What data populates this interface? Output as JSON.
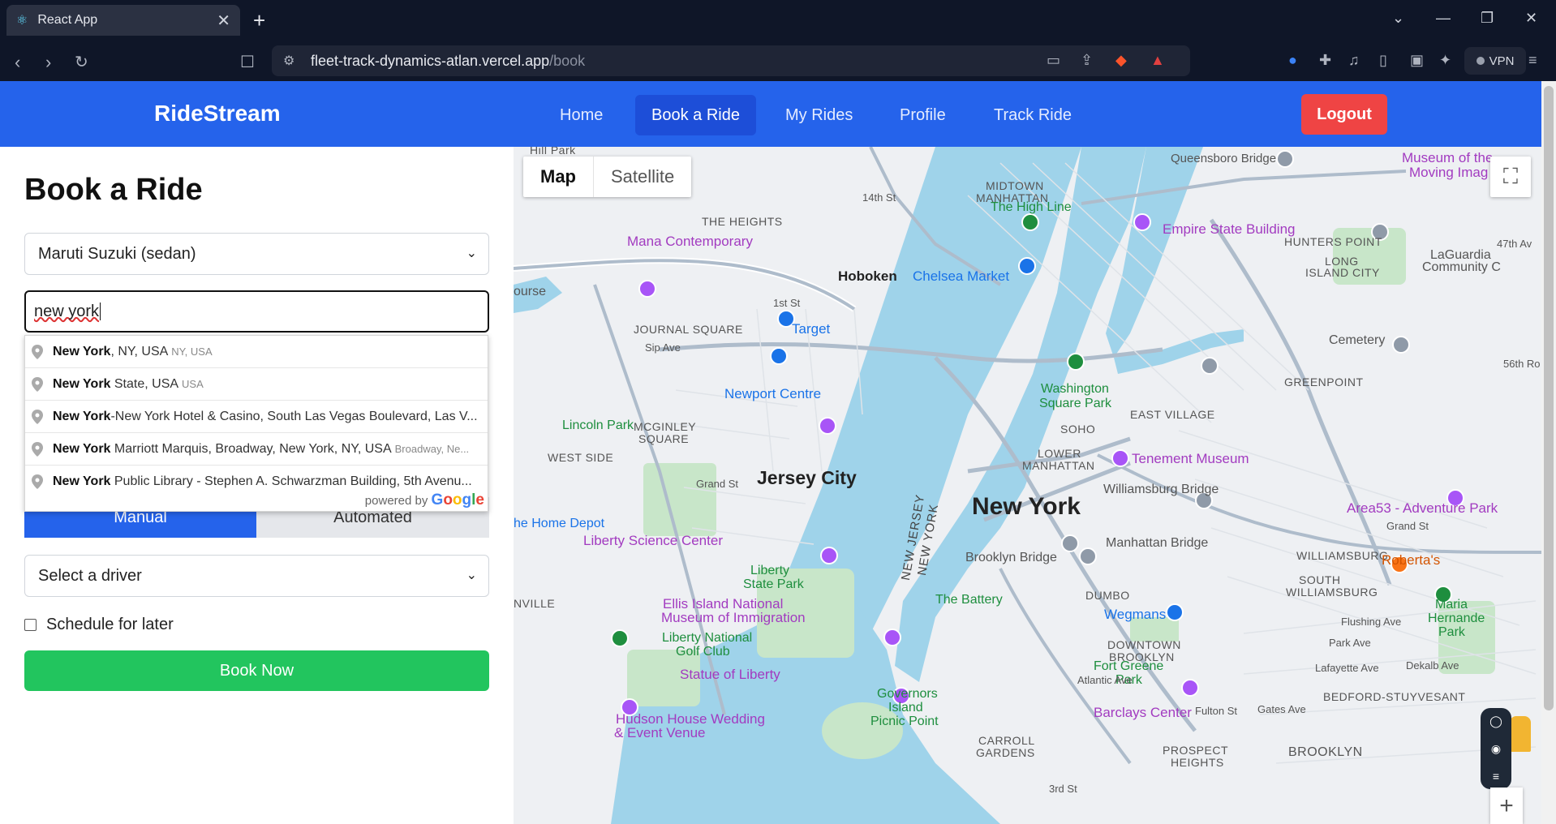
{
  "browser": {
    "tab_title": "React App",
    "tab_close": "✕",
    "new_tab": "+",
    "url_host": "fleet-track-dynamics-atlan.vercel.app",
    "url_path": "/book",
    "vpn_label": "VPN"
  },
  "header": {
    "brand": "RideStream",
    "nav": [
      {
        "label": "Home",
        "active": false
      },
      {
        "label": "Book a Ride",
        "active": true
      },
      {
        "label": "My Rides",
        "active": false
      },
      {
        "label": "Profile",
        "active": false
      },
      {
        "label": "Track Ride",
        "active": false
      }
    ],
    "logout": "Logout",
    "brand_color": "#2563eb",
    "logout_color": "#ef4444"
  },
  "form": {
    "title": "Book a Ride",
    "vehicle_selected": "Maruti Suzuki (sedan)",
    "location_value": "new york",
    "mode_manual": "Manual",
    "mode_automated": "Automated",
    "driver_selected": "Select a driver",
    "schedule_label": "Schedule for later",
    "schedule_checked": false,
    "book_button": "Book Now",
    "book_color": "#22c55e"
  },
  "autocomplete": {
    "items": [
      {
        "match": "New York",
        "rest": ", NY, USA",
        "secondary": "NY, USA"
      },
      {
        "match": "New York",
        "rest": " State, USA",
        "secondary": "USA"
      },
      {
        "match": "New York",
        "rest": "-New York Hotel & Casino, South Las Vegas Boulevard, Las V...",
        "secondary": ""
      },
      {
        "match": "New York",
        "rest": " Marriott Marquis, Broadway, New York, NY, USA",
        "secondary": "Broadway, Ne..."
      },
      {
        "match": "New York",
        "rest": " Public Library - Stephen A. Schwarzman Building, 5th Avenu...",
        "secondary": ""
      }
    ],
    "powered_by": "powered by",
    "google": [
      "G",
      "o",
      "o",
      "g",
      "l",
      "e"
    ]
  },
  "map": {
    "type_map": "Map",
    "type_satellite": "Satellite",
    "labels": {
      "hill_park": "Hill Park",
      "the_heights": "THE HEIGHTS",
      "hoboken": "Hoboken",
      "chelsea_market": "Chelsea Market",
      "the_high_line": "The High Line",
      "midtown": "MIDTOWN",
      "manhattan": "MANHATTAN",
      "queensboro": "Queensboro Bridge",
      "museum_moving": "Museum of the",
      "museum_moving2": "Moving Imag",
      "empire_state": "Empire State Building",
      "hunters_point": "HUNTERS POINT",
      "long_island": "LONG",
      "long_island2": "ISLAND CITY",
      "laguardia": "LaGuardia",
      "laguardia2": "Community C",
      "mana": "Mana Contemporary",
      "ourse": "ourse",
      "journal_square": "JOURNAL SQUARE",
      "target": "Target",
      "newport": "Newport Centre",
      "washington_sq": "Washington",
      "washington_sq2": "Square Park",
      "east_village": "EAST VILLAGE",
      "cemetery": "Cemetery",
      "greenpoint": "GREENPOINT",
      "lincoln_park": "Lincoln Park",
      "mcginley": "MCGINLEY",
      "mcginley2": "SQUARE",
      "west_side": "WEST SIDE",
      "soho": "SOHO",
      "lower": "LOWER",
      "lower2": "MANHATTAN",
      "tenement": "Tenement Museum",
      "jersey_city": "Jersey City",
      "new_york": "New York",
      "williamsburg_bridge": "Williamsburg Bridge",
      "area53": "Area53 - Adventure Park",
      "home_depot": "he Home Depot",
      "liberty_sci": "Liberty Science Center",
      "new_jersey": "NEW JERSEY",
      "new_york_state": "NEW YORK",
      "manhattan_bridge": "Manhattan Bridge",
      "williamsburg": "WILLIAMSBURG",
      "south_williamsburg": "SOUTH",
      "south_williamsburg2": "WILLIAMSBURG",
      "robertas": "Roberta's",
      "liberty_state": "Liberty",
      "liberty_state2": "State Park",
      "brooklyn_bridge": "Brooklyn Bridge",
      "the_battery": "The Battery",
      "dumbo": "DUMBO",
      "ellis": "Ellis Island National",
      "ellis2": "Museum of Immigration",
      "nville": "NVILLE",
      "wegmans": "Wegmans",
      "liberty_golf": "Liberty National",
      "liberty_golf2": "Golf Club",
      "downtown": "DOWNTOWN",
      "downtown2": "BROOKLYN",
      "maria": "Maria",
      "maria2": "Hernande",
      "maria3": "Park",
      "statue": "Statue of Liberty",
      "fort_greene": "Fort Greene",
      "fort_greene2": "Park",
      "hudson_house": "Hudson House Wedding",
      "hudson_house2": "& Event Venue",
      "governors": "Governors",
      "governors2": "Island",
      "governors3": "Picnic Point",
      "barclays": "Barclays Center",
      "bedford": "BEDFORD-STUYVESANT",
      "carroll": "CARROLL",
      "carroll2": "GARDENS",
      "prospect": "PROSPECT",
      "prospect2": "HEIGHTS",
      "brooklyn": "BROOKLYN",
      "st14": "14th St",
      "st1": "1st St",
      "grand_st": "Grand St",
      "grand_st2": "Grand St",
      "sip_ave": "Sip Ave",
      "park_ave": "Park Ave",
      "flushing": "Flushing Ave",
      "gates": "Gates Ave",
      "fulton": "Fulton St",
      "atlantic": "Atlantic Ave",
      "lafayette": "Lafayette Ave",
      "dekalb": "Dekalb Ave",
      "st3": "3rd St",
      "st47": "47th Av",
      "st56": "56th Ro"
    }
  }
}
